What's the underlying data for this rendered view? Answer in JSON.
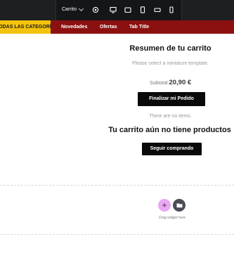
{
  "toolbar": {
    "menu_label": "Carrito",
    "icons": [
      "settings-icon",
      "desktop-icon",
      "laptop-icon",
      "tablet-icon",
      "tablet-landscape-icon",
      "mobile-icon"
    ]
  },
  "nav": {
    "categories_label": "TODAS LAS CATEGORÍAS",
    "links": [
      "Novedades",
      "Ofertas",
      "Tab Title"
    ]
  },
  "cart": {
    "title": "Resumen de tu carrito",
    "template_note": "Please select a miniature template.",
    "subtotal_label": "Subtotal:",
    "subtotal_value": "20,90 €",
    "checkout_button": "Finalizar mi Pedido",
    "no_items": "There are no items.",
    "empty_heading": "Tu carrito aún no tiene productos",
    "continue_button": "Seguir comprando"
  },
  "dropzone": {
    "drag_text": "Drag widget here"
  },
  "colors": {
    "toolbar_bg": "#1e1f21",
    "nav_bg": "#8b1111",
    "categories_bg": "#f4c20d",
    "button_bg": "#0a0a0a",
    "add_button": "#e8a8f2",
    "folder_button": "#4a4d55"
  }
}
